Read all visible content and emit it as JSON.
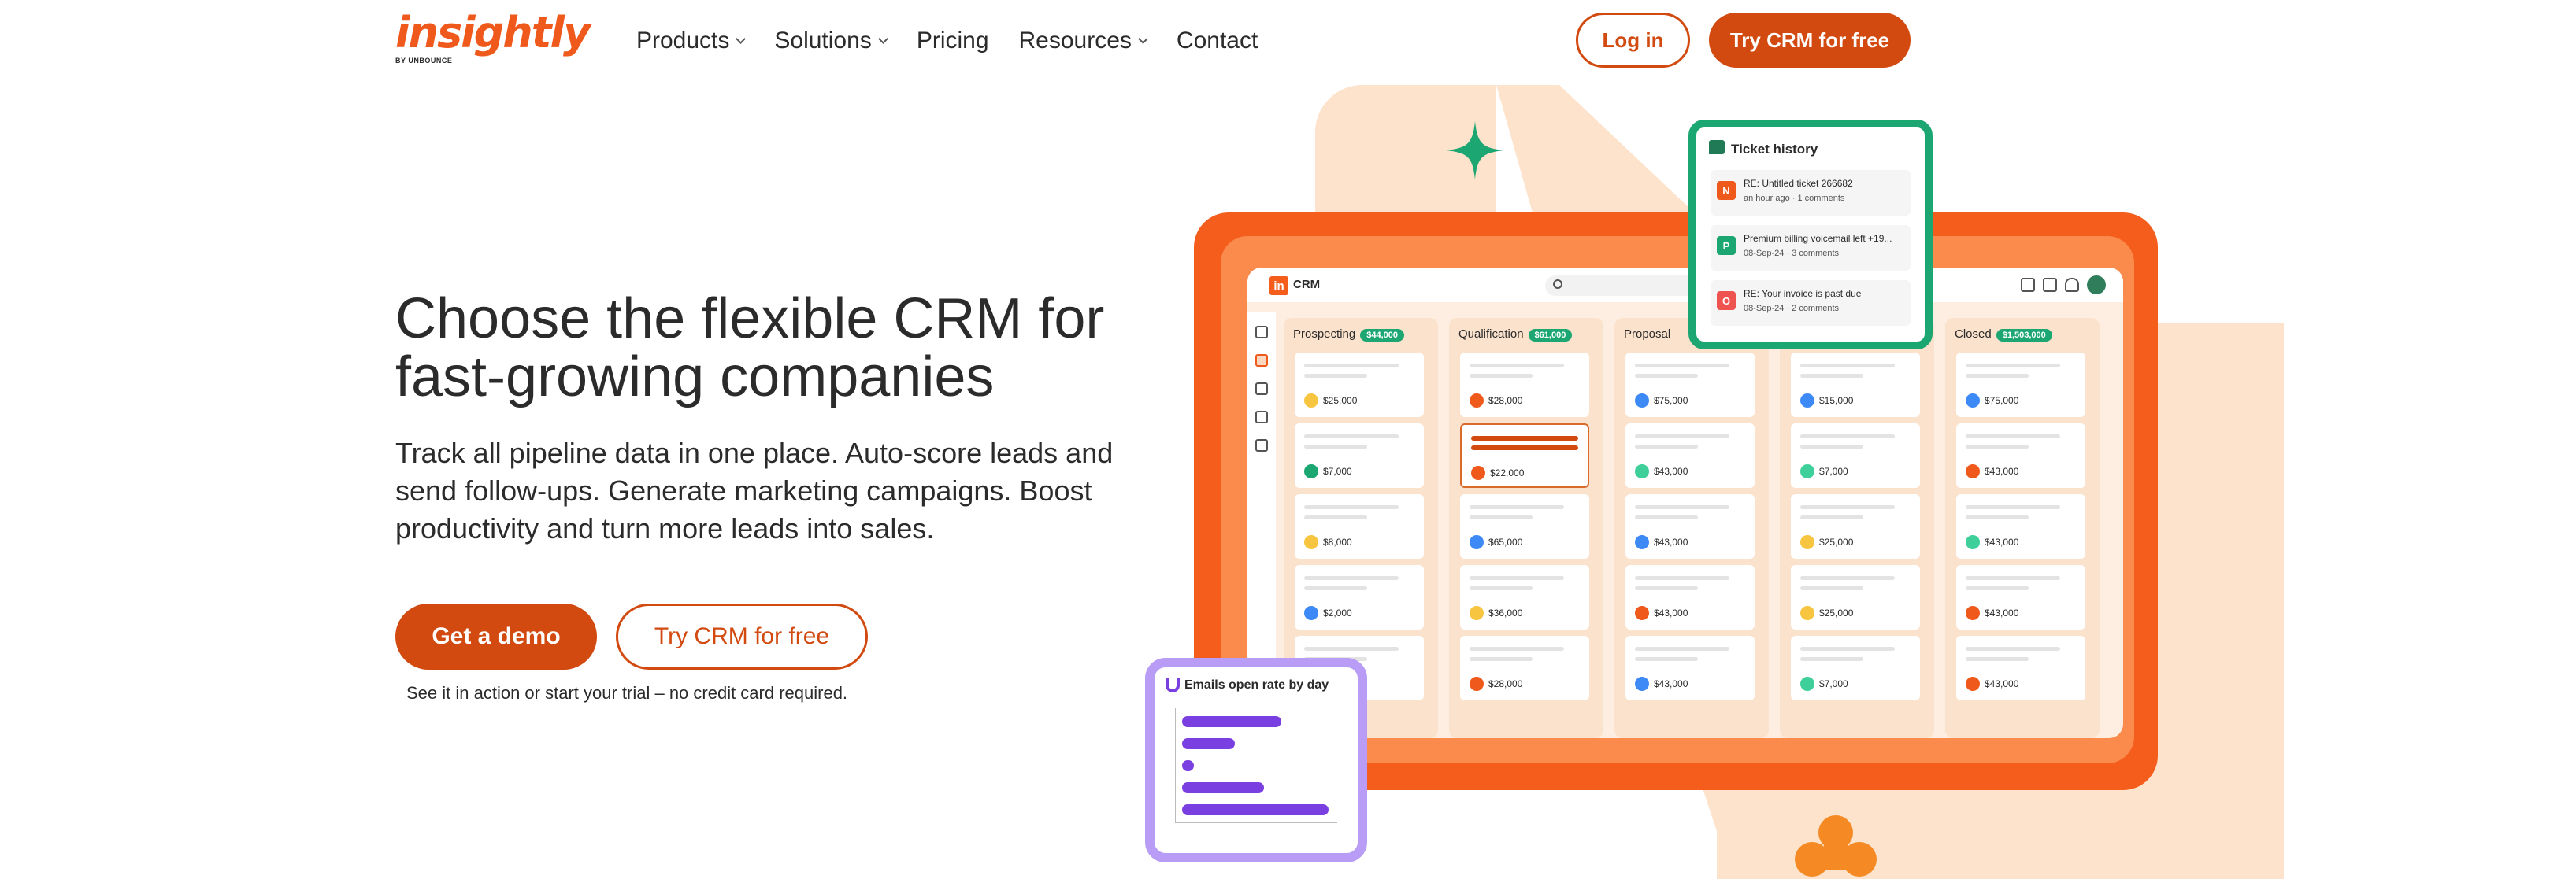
{
  "header": {
    "logo": {
      "word": "insightly",
      "byline": "BY UNBOUNCE"
    },
    "nav": [
      {
        "label": "Products",
        "has_dropdown": true
      },
      {
        "label": "Solutions",
        "has_dropdown": true
      },
      {
        "label": "Pricing",
        "has_dropdown": false
      },
      {
        "label": "Resources",
        "has_dropdown": true
      },
      {
        "label": "Contact",
        "has_dropdown": false
      }
    ],
    "login_label": "Log in",
    "try_label": "Try CRM for free"
  },
  "hero": {
    "title": "Choose the flexible CRM for fast-growing companies",
    "description": "Track all pipeline data in one place. Auto-score leads and send follow-ups. Generate marketing campaigns. Boost productivity and turn more leads into sales.",
    "demo_label": "Get a demo",
    "try_label": "Try CRM for free",
    "note": "See it in action or start your trial – no credit card required."
  },
  "crm": {
    "app_name": "CRM",
    "logo_letters": "in",
    "columns": [
      {
        "title": "Prospecting",
        "badge": "$44,000",
        "cards": [
          {
            "amount": "$25,000",
            "dot": "#f7c53f"
          },
          {
            "amount": "$7,000",
            "dot": "#1ba672"
          },
          {
            "amount": "$8,000",
            "dot": "#f7c53f"
          },
          {
            "amount": "$2,000",
            "dot": "#3d8af7"
          },
          {
            "amount": "",
            "dot": ""
          }
        ]
      },
      {
        "title": "Qualification",
        "badge": "$61,000",
        "cards": [
          {
            "amount": "$28,000",
            "dot": "#f0591c"
          },
          {
            "amount": "$22,000",
            "dot": "#f0591c",
            "selected": true
          },
          {
            "amount": "$65,000",
            "dot": "#3d8af7"
          },
          {
            "amount": "$36,000",
            "dot": "#f7c53f"
          },
          {
            "amount": "$28,000",
            "dot": "#f0591c"
          }
        ]
      },
      {
        "title": "Proposal",
        "badge": "",
        "cards": [
          {
            "amount": "$75,000",
            "dot": "#3d8af7"
          },
          {
            "amount": "$43,000",
            "dot": "#3fcf9a"
          },
          {
            "amount": "$43,000",
            "dot": "#3d8af7"
          },
          {
            "amount": "$43,000",
            "dot": "#f0591c"
          },
          {
            "amount": "$43,000",
            "dot": "#3d8af7"
          }
        ]
      },
      {
        "title": "",
        "badge": "",
        "cards": [
          {
            "amount": "$15,000",
            "dot": "#3d8af7"
          },
          {
            "amount": "$7,000",
            "dot": "#3fcf9a"
          },
          {
            "amount": "$25,000",
            "dot": "#f7c53f"
          },
          {
            "amount": "$25,000",
            "dot": "#f7c53f"
          },
          {
            "amount": "$7,000",
            "dot": "#3fcf9a"
          }
        ]
      },
      {
        "title": "Closed",
        "badge": "$1,503,000",
        "cards": [
          {
            "amount": "$75,000",
            "dot": "#3d8af7"
          },
          {
            "amount": "$43,000",
            "dot": "#f0591c"
          },
          {
            "amount": "$43,000",
            "dot": "#3fcf9a"
          },
          {
            "amount": "$43,000",
            "dot": "#f0591c"
          },
          {
            "amount": "$43,000",
            "dot": "#f0591c"
          }
        ]
      }
    ]
  },
  "ticket_history": {
    "title": "Ticket history",
    "items": [
      {
        "badge": "N",
        "color": "#f0591c",
        "text": "RE: Untitled ticket 266682",
        "sub": "an hour ago · 1 comments"
      },
      {
        "badge": "P",
        "color": "#1ba672",
        "text": "Premium billing voicemail left +19...",
        "sub": "08-Sep-24 · 3 comments"
      },
      {
        "badge": "O",
        "color": "#ef5350",
        "text": "RE: Your invoice is past due",
        "sub": "08-Sep-24 · 2 comments"
      }
    ]
  },
  "emails_widget": {
    "title": "Emails open rate by day",
    "bars": [
      0.68,
      0.36,
      0.08,
      0.56,
      1.0
    ]
  },
  "colors": {
    "brand": "#d24a10",
    "orange": "#f45d1c",
    "green": "#1ba672",
    "purple": "#7a3fe0",
    "peach": "#fde3cc"
  }
}
